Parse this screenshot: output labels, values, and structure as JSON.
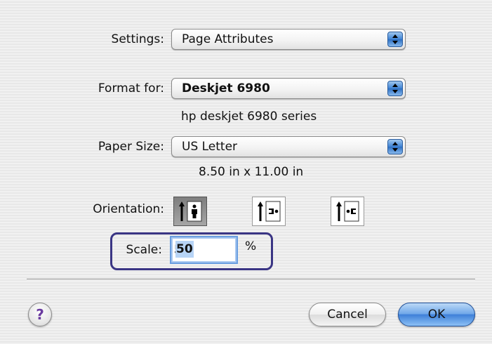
{
  "settings": {
    "label": "Settings:",
    "value": "Page Attributes"
  },
  "format_for": {
    "label": "Format for:",
    "value": "Deskjet 6980",
    "description": "hp deskjet 6980 series"
  },
  "paper_size": {
    "label": "Paper Size:",
    "value": "US Letter",
    "dimensions": "8.50 in x 11.00 in"
  },
  "orientation": {
    "label": "Orientation:",
    "options": [
      "portrait",
      "landscape-left",
      "landscape-right"
    ],
    "selected": "portrait"
  },
  "scale": {
    "label": "Scale:",
    "value": "50",
    "unit": "%"
  },
  "buttons": {
    "help": "?",
    "cancel": "Cancel",
    "ok": "OK"
  },
  "colors": {
    "accent": "#3d7fd8",
    "highlight_border": "#3a3584"
  }
}
